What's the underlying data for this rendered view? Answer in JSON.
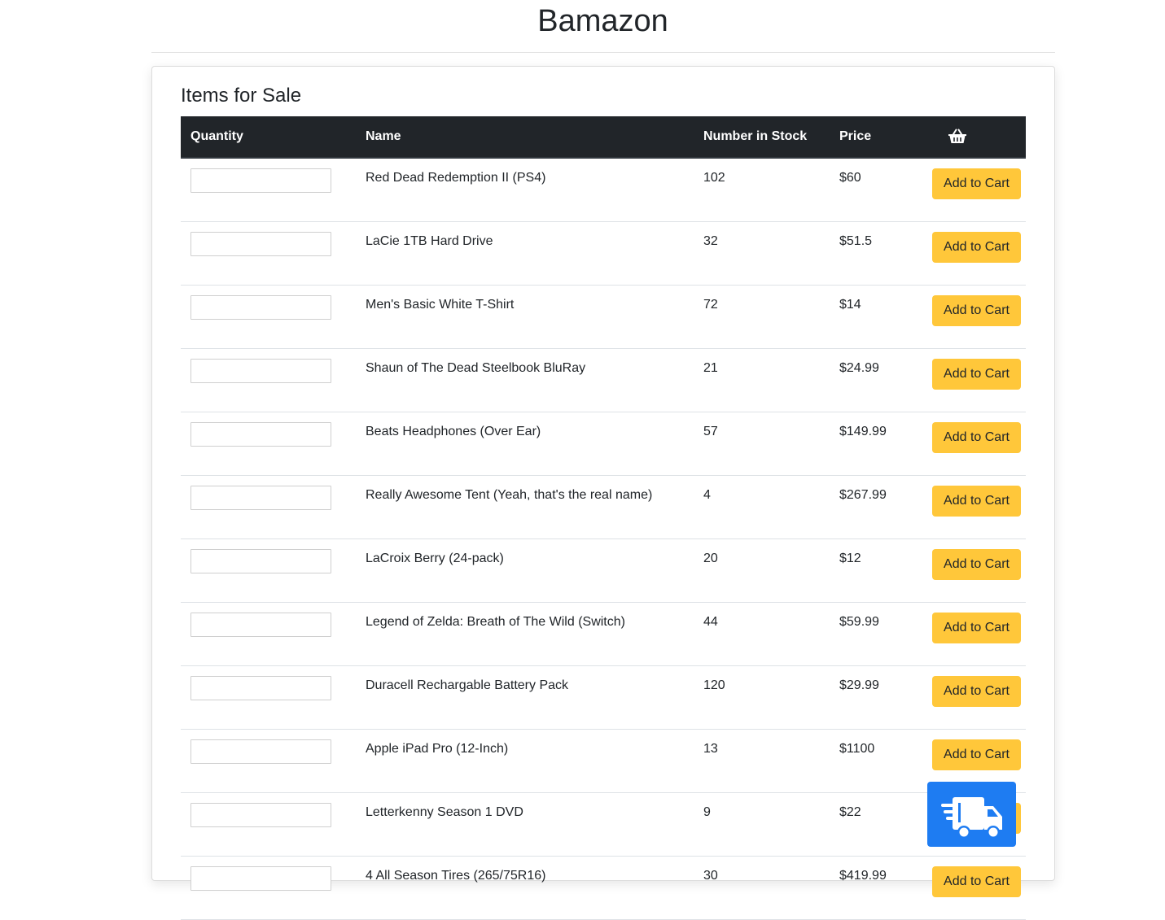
{
  "site": {
    "title": "Bamazon"
  },
  "section": {
    "title": "Items for Sale"
  },
  "table": {
    "headers": {
      "quantity": "Quantity",
      "name": "Name",
      "stock": "Number in Stock",
      "price": "Price",
      "cart_icon": "basket-icon"
    },
    "add_label": "Add to Cart",
    "rows": [
      {
        "name": "Red Dead Redemption II (PS4)",
        "stock": "102",
        "price": "$60"
      },
      {
        "name": "LaCie 1TB Hard Drive",
        "stock": "32",
        "price": "$51.5"
      },
      {
        "name": "Men's Basic White T-Shirt",
        "stock": "72",
        "price": "$14"
      },
      {
        "name": "Shaun of The Dead Steelbook BluRay",
        "stock": "21",
        "price": "$24.99"
      },
      {
        "name": "Beats Headphones (Over Ear)",
        "stock": "57",
        "price": "$149.99"
      },
      {
        "name": "Really Awesome Tent (Yeah, that's the real name)",
        "stock": "4",
        "price": "$267.99"
      },
      {
        "name": "LaCroix Berry (24-pack)",
        "stock": "20",
        "price": "$12"
      },
      {
        "name": "Legend of Zelda: Breath of The Wild (Switch)",
        "stock": "44",
        "price": "$59.99"
      },
      {
        "name": "Duracell Rechargable Battery Pack",
        "stock": "120",
        "price": "$29.99"
      },
      {
        "name": "Apple iPad Pro (12-Inch)",
        "stock": "13",
        "price": "$1100"
      },
      {
        "name": "Letterkenny Season 1 DVD",
        "stock": "9",
        "price": "$22"
      },
      {
        "name": "4 All Season Tires (265/75R16)",
        "stock": "30",
        "price": "$419.99"
      }
    ]
  },
  "checkout": {
    "icon": "delivery-truck-icon"
  },
  "colors": {
    "header_bg": "#212529",
    "button_warning": "#ffc73a",
    "button_primary": "#1e7cf2"
  }
}
